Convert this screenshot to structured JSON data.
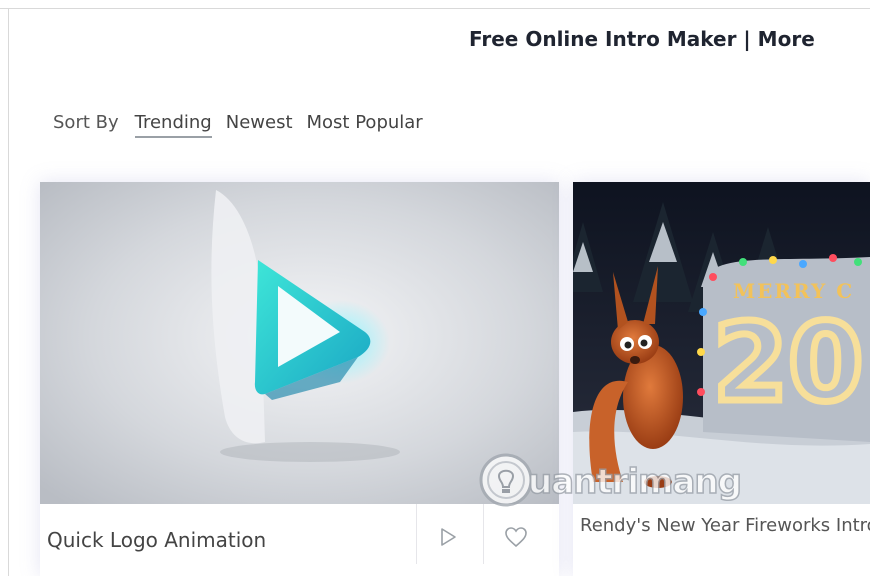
{
  "header": {
    "title": "Free Online Intro Maker | More"
  },
  "sort": {
    "label": "Sort By",
    "options": [
      {
        "label": "Trending",
        "active": true
      },
      {
        "label": "Newest",
        "active": false
      },
      {
        "label": "Most Popular",
        "active": false
      }
    ]
  },
  "cards": [
    {
      "title": "Quick Logo Animation",
      "icons": [
        "play-icon",
        "heart-icon"
      ]
    },
    {
      "title": "Rendy's New Year Fireworks Intro",
      "thumb_text_top": "MERRY C",
      "thumb_text_number": "20"
    }
  ],
  "watermark": {
    "text": "uantrimang"
  },
  "colors": {
    "accent": "#2ec4c8",
    "title": "#1f2430",
    "sort_underline": "#9aa0a6"
  }
}
